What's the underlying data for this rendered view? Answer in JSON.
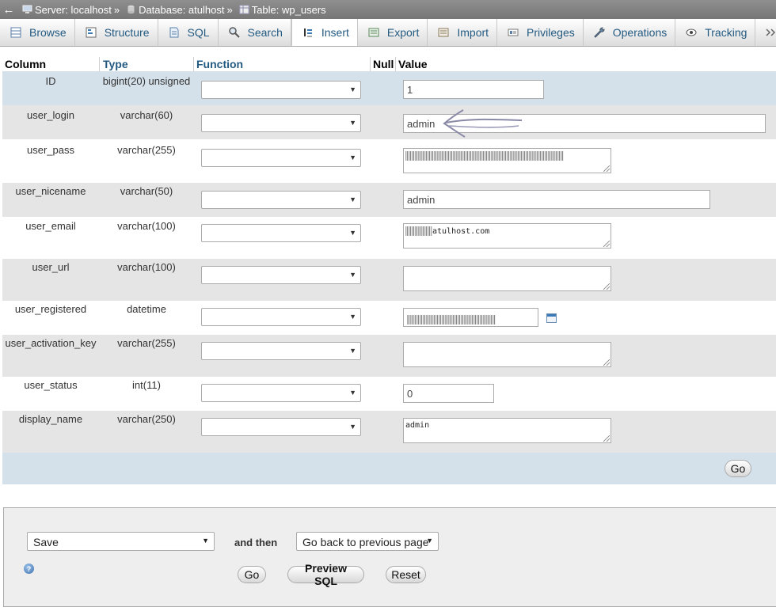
{
  "breadcrumb": {
    "back": "←",
    "server": "Server: localhost",
    "database": "Database: atulhost",
    "table": "Table: wp_users",
    "separator": "»"
  },
  "tabs": [
    {
      "label": "Browse",
      "icon": "browse-icon"
    },
    {
      "label": "Structure",
      "icon": "structure-icon"
    },
    {
      "label": "SQL",
      "icon": "sql-icon"
    },
    {
      "label": "Search",
      "icon": "search-icon"
    },
    {
      "label": "Insert",
      "icon": "insert-icon",
      "active": true
    },
    {
      "label": "Export",
      "icon": "export-icon"
    },
    {
      "label": "Import",
      "icon": "import-icon"
    },
    {
      "label": "Privileges",
      "icon": "privileges-icon"
    },
    {
      "label": "Operations",
      "icon": "operations-icon"
    },
    {
      "label": "Tracking",
      "icon": "tracking-icon"
    }
  ],
  "table": {
    "headers": {
      "column": "Column",
      "type": "Type",
      "function": "Function",
      "null": "Null",
      "value": "Value"
    },
    "rows": [
      {
        "column": "ID",
        "type": "bigint(20) unsigned",
        "value": "1"
      },
      {
        "column": "user_login",
        "type": "varchar(60)",
        "value": "admin"
      },
      {
        "column": "user_pass",
        "type": "varchar(255)",
        "value": ""
      },
      {
        "column": "user_nicename",
        "type": "varchar(50)",
        "value": "admin"
      },
      {
        "column": "user_email",
        "type": "varchar(100)",
        "value": "atulhost.com"
      },
      {
        "column": "user_url",
        "type": "varchar(100)",
        "value": ""
      },
      {
        "column": "user_registered",
        "type": "datetime",
        "value": ""
      },
      {
        "column": "user_activation_key",
        "type": "varchar(255)",
        "value": ""
      },
      {
        "column": "user_status",
        "type": "int(11)",
        "value": "0"
      },
      {
        "column": "display_name",
        "type": "varchar(250)",
        "value": "admin"
      }
    ],
    "go_label": "Go"
  },
  "footer": {
    "action_select": "Save",
    "and_then": "and then",
    "after_select": "Go back to previous page",
    "go_label": "Go",
    "preview_label": "Preview SQL",
    "reset_label": "Reset"
  },
  "colors": {
    "link": "#235a81",
    "row_highlight": "#d5e1ea",
    "row_alt": "#e5e5e5"
  }
}
